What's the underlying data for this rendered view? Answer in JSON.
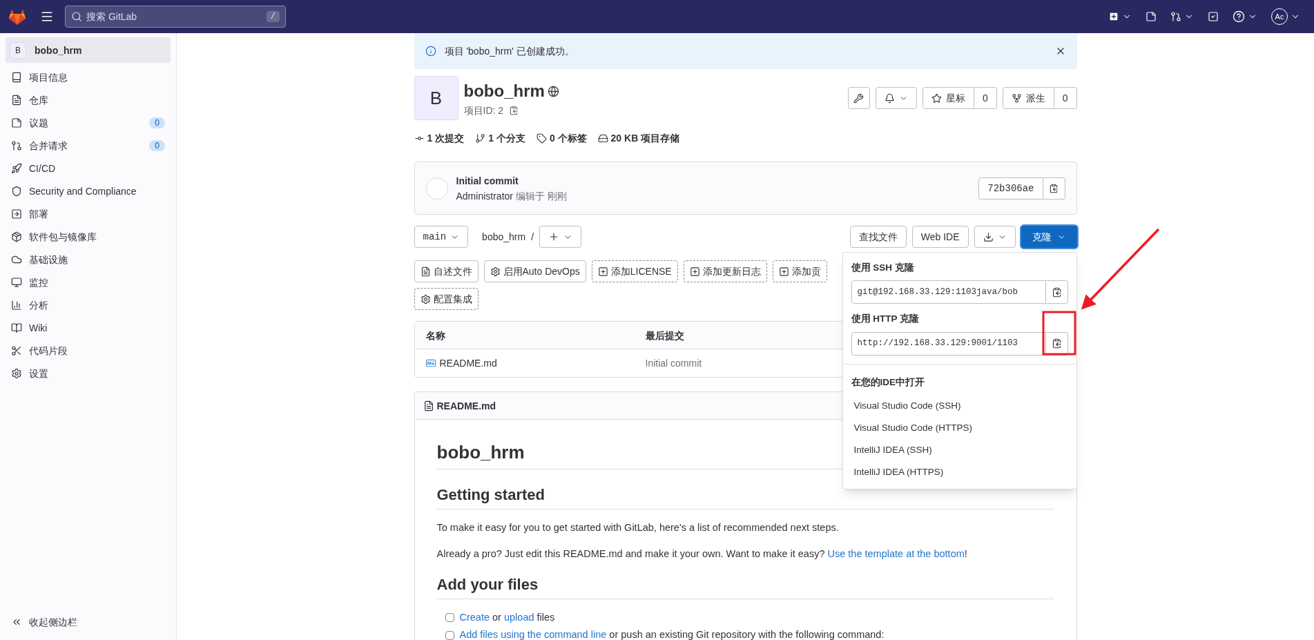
{
  "top_bar": {
    "search": {
      "placeholder": "搜索 GitLab",
      "shortcut": "/"
    },
    "avatar": "Ac"
  },
  "sidebar": {
    "project": {
      "initial": "B",
      "name": "bobo_hrm",
      "selected": true
    },
    "items": [
      {
        "label": "项目信息"
      },
      {
        "label": "仓库"
      },
      {
        "label": "议题",
        "badge": "0"
      },
      {
        "label": "合并请求",
        "badge": "0"
      },
      {
        "label": "CI/CD"
      },
      {
        "label": "Security and Compliance"
      },
      {
        "label": "部署"
      },
      {
        "label": "软件包与镜像库"
      },
      {
        "label": "基础设施"
      },
      {
        "label": "监控"
      },
      {
        "label": "分析"
      },
      {
        "label": "Wiki"
      },
      {
        "label": "代码片段"
      },
      {
        "label": "设置"
      }
    ],
    "collapse": "收起侧边栏"
  },
  "alert": {
    "text": "项目 'bobo_hrm' 已创建成功。"
  },
  "project": {
    "initial": "B",
    "name": "bobo_hrm",
    "id_label": "项目ID: 2",
    "star": {
      "label": "星标",
      "count": "0"
    },
    "fork": {
      "label": "派生",
      "count": "0"
    }
  },
  "stats": [
    "1 次提交",
    "1 个分支",
    "0 个标签",
    "20 KB 项目存储"
  ],
  "commit": {
    "title": "Initial commit",
    "author": "Administrator",
    "meta": "编辑于 刚刚",
    "sha": "72b306ae"
  },
  "repo_bar": {
    "branch": "main",
    "path": "bobo_hrm",
    "separator": "/",
    "find_file": "查找文件",
    "web_ide": "Web IDE",
    "clone": "克隆"
  },
  "shortcuts": [
    {
      "label": "自述文件",
      "kind": "file"
    },
    {
      "label": "启用Auto DevOps",
      "kind": "gear"
    },
    {
      "label": "添加LICENSE",
      "kind": "add"
    },
    {
      "label": "添加更新日志",
      "kind": "add"
    },
    {
      "label": "添加贡",
      "kind": "add"
    },
    {
      "label": "配置集成",
      "kind": "setup"
    }
  ],
  "file_table": {
    "columns": [
      "名称",
      "最后提交"
    ],
    "rows": [
      {
        "name": "README.md",
        "commit": "Initial commit"
      }
    ]
  },
  "readme": {
    "filename": "README.md",
    "blocks": [
      {
        "kind": "h1",
        "text": "bobo_hrm"
      },
      {
        "kind": "h2",
        "text": "Getting started"
      },
      {
        "kind": "p",
        "parts": [
          {
            "kind": "text",
            "text": "To make it easy for you to get started with GitLab, here's a list of recommended next steps."
          }
        ]
      },
      {
        "kind": "p",
        "parts": [
          {
            "kind": "text",
            "text": "Already a pro? Just edit this README.md and make it your own. Want to make it easy? "
          },
          {
            "kind": "link",
            "text": "Use the template at the bottom"
          },
          {
            "kind": "text",
            "text": "!"
          }
        ]
      },
      {
        "kind": "h2",
        "text": "Add your files"
      },
      {
        "kind": "task",
        "checked": false,
        "parts": [
          {
            "kind": "link",
            "text": "Create"
          },
          {
            "kind": "text",
            "text": " or "
          },
          {
            "kind": "link",
            "text": "upload"
          },
          {
            "kind": "text",
            "text": " files"
          }
        ]
      },
      {
        "kind": "task",
        "checked": false,
        "parts": [
          {
            "kind": "link",
            "text": "Add files using the command line"
          },
          {
            "kind": "text",
            "text": " or push an existing Git repository with the following command:"
          }
        ]
      }
    ]
  },
  "clone_dropdown": {
    "ssh_label": "使用 SSH 克隆",
    "ssh_url": "git@192.168.33.129:1103java/bob",
    "http_label": "使用 HTTP 克隆",
    "http_url": "http://192.168.33.129:9001/1103",
    "ide_label": "在您的IDE中打开",
    "ide_items": [
      "Visual Studio Code (SSH)",
      "Visual Studio Code (HTTPS)",
      "IntelliJ IDEA (SSH)",
      "IntelliJ IDEA (HTTPS)"
    ]
  }
}
